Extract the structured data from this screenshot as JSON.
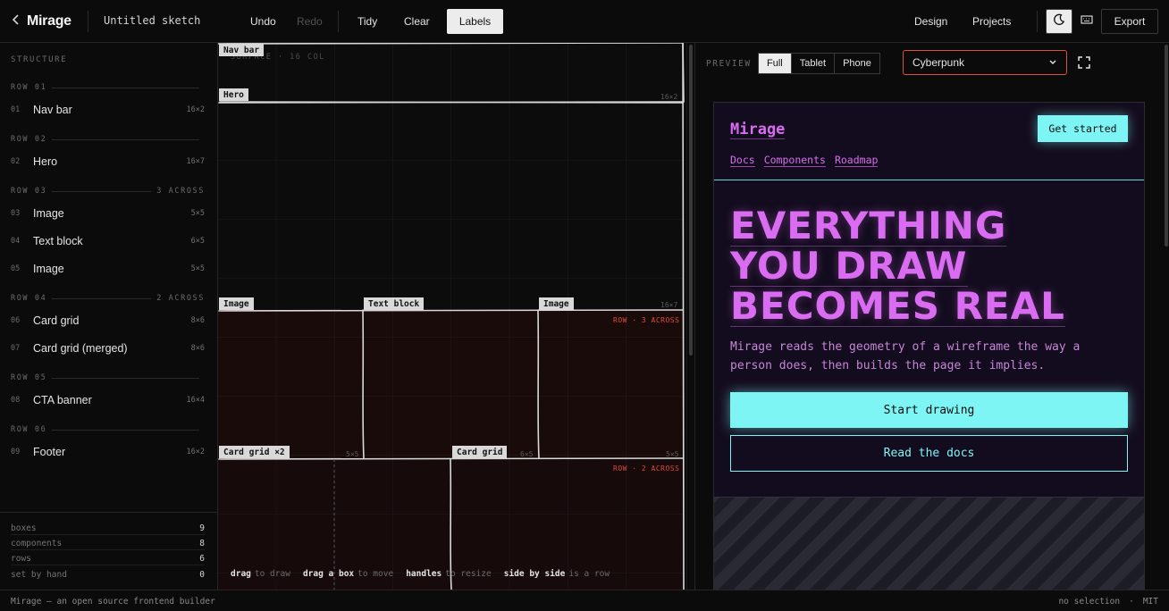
{
  "topbar": {
    "brand": "Mirage",
    "sketch_title": "Untitled sketch",
    "undo": "Undo",
    "redo": "Redo",
    "tidy": "Tidy",
    "clear": "Clear",
    "labels": "Labels",
    "design": "Design",
    "projects": "Projects",
    "export": "Export"
  },
  "sidebar": {
    "heading": "STRUCTURE",
    "rows": [
      {
        "label": "ROW 01",
        "note": ""
      },
      {
        "label": "ROW 02",
        "note": ""
      },
      {
        "label": "ROW 03",
        "note": "3 ACROSS"
      },
      {
        "label": "ROW 04",
        "note": "2 ACROSS"
      },
      {
        "label": "ROW 05",
        "note": ""
      },
      {
        "label": "ROW 06",
        "note": ""
      }
    ],
    "components": [
      {
        "num": "01",
        "label": "Nav bar",
        "dims": "16×2"
      },
      {
        "num": "02",
        "label": "Hero",
        "dims": "16×7"
      },
      {
        "num": "03",
        "label": "Image",
        "dims": "5×5"
      },
      {
        "num": "04",
        "label": "Text block",
        "dims": "6×5"
      },
      {
        "num": "05",
        "label": "Image",
        "dims": "5×5"
      },
      {
        "num": "06",
        "label": "Card grid",
        "dims": "8×6"
      },
      {
        "num": "07",
        "label": "Card grid (merged)",
        "dims": "8×6"
      },
      {
        "num": "08",
        "label": "CTA banner",
        "dims": "16×4"
      },
      {
        "num": "09",
        "label": "Footer",
        "dims": "16×2"
      }
    ],
    "stats": [
      {
        "label": "boxes",
        "value": "9"
      },
      {
        "label": "components",
        "value": "8"
      },
      {
        "label": "rows",
        "value": "6"
      },
      {
        "label": "set by hand",
        "value": "0"
      }
    ]
  },
  "canvas": {
    "surface": "SURFACE · 16 COL",
    "tags": {
      "navbar": "Nav bar",
      "hero": "Hero",
      "image1": "Image",
      "textblock": "Text block",
      "image2": "Image",
      "cardgrid_merged": "Card grid ×2",
      "cardgrid": "Card grid"
    },
    "dims": {
      "hero": "16×2",
      "row3": "16×7",
      "image1": "5×5",
      "textblock": "6×5",
      "image2": "5×5"
    },
    "row_labels": {
      "row3": "ROW · 3 ACROSS",
      "row4": "ROW · 2 ACROSS"
    },
    "hints": [
      {
        "key": "drag",
        "text": "to draw"
      },
      {
        "key": "drag a box",
        "text": "to move"
      },
      {
        "key": "handles",
        "text": "to resize"
      },
      {
        "key": "side by side",
        "text": "is a row"
      }
    ]
  },
  "preview": {
    "label": "PREVIEW",
    "modes": [
      "Full",
      "Tablet",
      "Phone"
    ],
    "active_mode": "Full",
    "theme": "Cyberpunk",
    "site": {
      "brand": "Mirage",
      "cta": "Get started",
      "nav": [
        "Docs",
        "Components",
        "Roadmap"
      ],
      "hero_lines": [
        "EVERYTHING",
        "YOU DRAW",
        "BECOMES REAL"
      ],
      "lead": "Mirage reads the geometry of a wireframe the way a person does, then builds the page it implies.",
      "primary_button": "Start drawing",
      "secondary_button": "Read the docs"
    },
    "colors": {
      "accent_pink": "#d96cf0",
      "accent_cyan": "#7ef5f5",
      "theme_border": "#e0503a"
    }
  },
  "statusbar": {
    "left": "Mirage — an open source frontend builder",
    "selection": "no selection",
    "sep": "·",
    "license": "MIT"
  }
}
